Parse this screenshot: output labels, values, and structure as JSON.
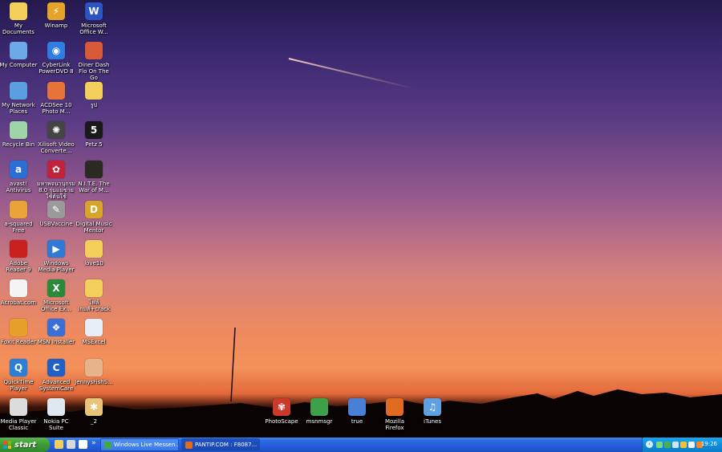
{
  "desktop": {
    "icons": [
      {
        "label": "My Documents",
        "glyph": "folder-docs-icon",
        "color": "#f2cf5b",
        "symbol": ""
      },
      {
        "label": "My Computer",
        "glyph": "computer-icon",
        "color": "#6fa8e8",
        "symbol": ""
      },
      {
        "label": "My Network Places",
        "glyph": "network-icon",
        "color": "#5aa0e0",
        "symbol": ""
      },
      {
        "label": "Recycle Bin",
        "glyph": "recycle-bin-icon",
        "color": "#9fd4a8",
        "symbol": ""
      },
      {
        "label": "avast! Antivirus",
        "glyph": "avast-icon",
        "color": "#2b6fd6",
        "symbol": "a"
      },
      {
        "label": "a-squared Free",
        "glyph": "a-squared-icon",
        "color": "#e9a33a",
        "symbol": ""
      },
      {
        "label": "Adobe Reader 9",
        "glyph": "adobe-reader-icon",
        "color": "#c8201c",
        "symbol": ""
      },
      {
        "label": "Acrobat.com",
        "glyph": "acrobat-icon",
        "color": "#f4f4f4",
        "symbol": ""
      },
      {
        "label": "Foxit Reader",
        "glyph": "foxit-icon",
        "color": "#e6a02a",
        "symbol": ""
      },
      {
        "label": "QuickTime Player",
        "glyph": "quicktime-icon",
        "color": "#2a7fd8",
        "symbol": "Q"
      },
      {
        "label": "Media Player Classic",
        "glyph": "mpc-icon",
        "color": "#dcdcdc",
        "symbol": ""
      },
      {
        "label": "Winamp",
        "glyph": "winamp-icon",
        "color": "#e5a32a",
        "symbol": "⚡"
      },
      {
        "label": "CyberLink PowerDVD 8",
        "glyph": "powerdvd-icon",
        "color": "#2f7de0",
        "symbol": "◉"
      },
      {
        "label": "ACDSee 10 Photo M...",
        "glyph": "acdsee-icon",
        "color": "#e7733a",
        "symbol": ""
      },
      {
        "label": "Xilisoft Video Converte...",
        "glyph": "film-reel-icon",
        "color": "#444444",
        "symbol": "✺"
      },
      {
        "label": "มหาพจนานุกรม 8.0 รุ่นแม่ข่ายใช้ต้นใช้",
        "glyph": "dictionary-icon",
        "color": "#c2223a",
        "symbol": "✿"
      },
      {
        "label": "USBVaccine",
        "glyph": "usb-vaccine-icon",
        "color": "#9a9a9a",
        "symbol": "✎"
      },
      {
        "label": "Windows Media Player",
        "glyph": "wmp-icon",
        "color": "#2f7ad6",
        "symbol": "▶"
      },
      {
        "label": "Microsoft Office Ex...",
        "glyph": "excel-icon",
        "color": "#2a8a3a",
        "symbol": "X"
      },
      {
        "label": "MSN Installer",
        "glyph": "msn-butterfly-icon",
        "color": "#3a6fd8",
        "symbol": "❖"
      },
      {
        "label": "Advanced SystemCare",
        "glyph": "systemcare-icon",
        "color": "#1f5fc8",
        "symbol": "C"
      },
      {
        "label": "Nokia PC Suite",
        "glyph": "nokia-icon",
        "color": "#dfe8f0",
        "symbol": ""
      },
      {
        "label": "Microsoft Office W...",
        "glyph": "word-icon",
        "color": "#2b55c2",
        "symbol": "W"
      },
      {
        "label": "Diner Dash Flo On The Go",
        "glyph": "diner-dash-icon",
        "color": "#d65a3a",
        "symbol": ""
      },
      {
        "label": "รูป",
        "glyph": "folder-icon",
        "color": "#f2cf5b",
        "symbol": ""
      },
      {
        "label": "Petz 5",
        "glyph": "petz-icon",
        "color": "#1a1a1a",
        "symbol": "5"
      },
      {
        "label": "N.I.T.E. The War of M...",
        "glyph": "nite-game-icon",
        "color": "#2a2a22",
        "symbol": ""
      },
      {
        "label": "Digital Music Mentor",
        "glyph": "music-mentor-icon",
        "color": "#d9a42a",
        "symbol": "D"
      },
      {
        "label": "love10",
        "glyph": "folder-icon",
        "color": "#f2cf5b",
        "symbol": ""
      },
      {
        "label": "ไฟล์เกมส์+crack",
        "glyph": "folder-icon",
        "color": "#f2cf5b",
        "symbol": ""
      },
      {
        "label": "MSExcel",
        "glyph": "document-icon",
        "color": "#e8eef8",
        "symbol": ""
      },
      {
        "label": "JennysFishS...",
        "glyph": "jennys-fish-icon",
        "color": "#e6b38a",
        "symbol": ""
      },
      {
        "label": "_2",
        "glyph": "puzzle-icon",
        "color": "#e7c47a",
        "symbol": "✱"
      },
      {
        "label": "PhotoScape",
        "glyph": "photoscape-icon",
        "color": "#cc3a2a",
        "symbol": "✾"
      },
      {
        "label": "msnmsgr",
        "glyph": "msn-buddies-icon",
        "color": "#3fa04a",
        "symbol": ""
      },
      {
        "label": "true",
        "glyph": "true-icon",
        "color": "#4a7fd6",
        "symbol": ""
      },
      {
        "label": "Mozilla Firefox",
        "glyph": "firefox-icon",
        "color": "#e06a20",
        "symbol": ""
      },
      {
        "label": "iTunes",
        "glyph": "itunes-icon",
        "color": "#5fa0e0",
        "symbol": "♫"
      }
    ]
  },
  "taskbar": {
    "start_label": "start",
    "quicklaunch": [
      {
        "name": "ql-folder-icon",
        "color": "#f2cf5b"
      },
      {
        "name": "ql-media-icon",
        "color": "#d9d9d9"
      },
      {
        "name": "ql-edit-icon",
        "color": "#ffffff"
      }
    ],
    "more_label": "»",
    "tasks": [
      {
        "label": "Windows Live Messen...",
        "icon_color": "#43a648",
        "active": false
      },
      {
        "label": "PANTIP.COM : F8087...",
        "icon_color": "#e06a20",
        "active": true
      }
    ],
    "tray_arrow": "‹",
    "tray_icons": [
      {
        "name": "tray-network-icon",
        "color": "#7ad67f"
      },
      {
        "name": "tray-msn-icon",
        "color": "#4cae52"
      },
      {
        "name": "tray-monitor-icon",
        "color": "#cfe3f4"
      },
      {
        "name": "tray-shield-icon",
        "color": "#f0c23a"
      },
      {
        "name": "tray-volume-icon",
        "color": "#f4f4f4"
      },
      {
        "name": "tray-avast-icon",
        "color": "#f08a2a"
      }
    ],
    "clock": "19:26"
  }
}
